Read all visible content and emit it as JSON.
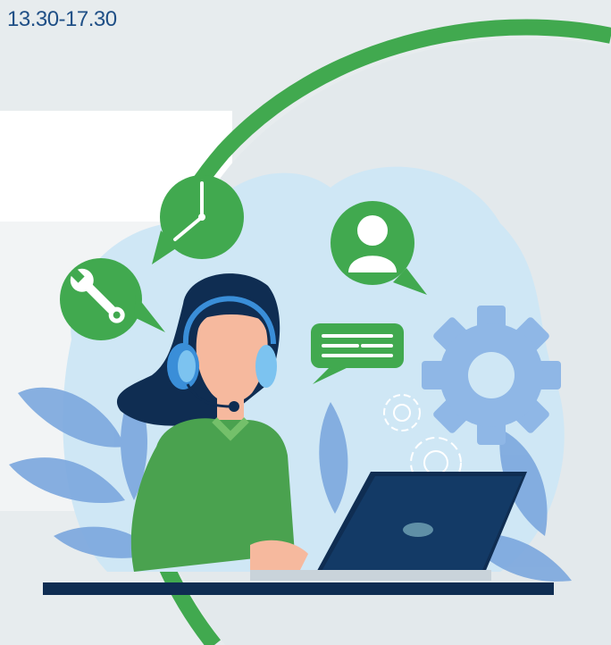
{
  "header": {
    "hours_text": "13.30-17.30"
  },
  "colors": {
    "accent_green": "#41a94f",
    "text_blue": "#1f4f86",
    "navy": "#0f2d52",
    "light_blue": "#cfe7f5",
    "gear_blue": "#8fb7e6",
    "skin": "#f6b99e",
    "shirt_green": "#4aa24f"
  },
  "icons": {
    "clock": "clock-icon",
    "wrench": "wrench-icon",
    "user": "user-icon",
    "chat": "chat-icon",
    "gear": "gear-icon"
  }
}
